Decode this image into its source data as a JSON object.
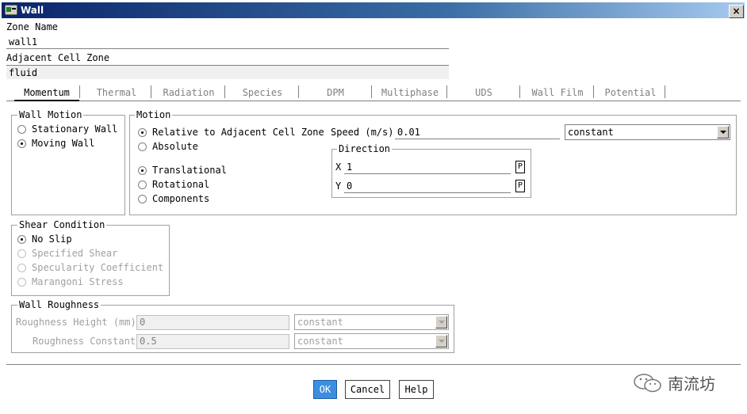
{
  "window": {
    "title": "Wall",
    "close_label": "×"
  },
  "zone_name": {
    "label": "Zone Name",
    "value": "wall1"
  },
  "adjacent_cell_zone": {
    "label": "Adjacent Cell Zone",
    "value": "fluid"
  },
  "tabs": [
    {
      "label": "Momentum",
      "active": true
    },
    {
      "label": "Thermal"
    },
    {
      "label": "Radiation"
    },
    {
      "label": "Species"
    },
    {
      "label": "DPM"
    },
    {
      "label": "Multiphase"
    },
    {
      "label": "UDS"
    },
    {
      "label": "Wall Film"
    },
    {
      "label": "Potential"
    }
  ],
  "wall_motion": {
    "legend": "Wall Motion",
    "options": [
      {
        "label": "Stationary Wall",
        "checked": false
      },
      {
        "label": "Moving Wall",
        "checked": true
      }
    ]
  },
  "motion": {
    "legend": "Motion",
    "reference": [
      {
        "label": "Relative to Adjacent Cell Zone",
        "checked": true
      },
      {
        "label": "Absolute",
        "checked": false
      }
    ],
    "type": [
      {
        "label": "Translational",
        "checked": true
      },
      {
        "label": "Rotational",
        "checked": false
      },
      {
        "label": "Components",
        "checked": false
      }
    ],
    "speed": {
      "label": "Speed (m/s)",
      "value": "0.01",
      "profile": "constant"
    },
    "direction": {
      "legend": "Direction",
      "x_label": "X",
      "x_value": "1",
      "y_label": "Y",
      "y_value": "0",
      "p_label": "P"
    }
  },
  "shear_condition": {
    "legend": "Shear Condition",
    "options": [
      {
        "label": "No Slip",
        "checked": true
      },
      {
        "label": "Specified Shear",
        "checked": false
      },
      {
        "label": "Specularity Coefficient",
        "checked": false
      },
      {
        "label": "Marangoni Stress",
        "checked": false
      }
    ]
  },
  "wall_roughness": {
    "legend": "Wall Roughness",
    "height": {
      "label": "Roughness Height (mm)",
      "value": "0",
      "profile": "constant"
    },
    "constant": {
      "label": "Roughness Constant",
      "value": "0.5",
      "profile": "constant"
    }
  },
  "buttons": {
    "ok": "OK",
    "cancel": "Cancel",
    "help": "Help"
  },
  "watermark": "南流坊",
  "colors": {
    "title_bar": "#0a246a",
    "ok_button": "#3c8fe0"
  }
}
